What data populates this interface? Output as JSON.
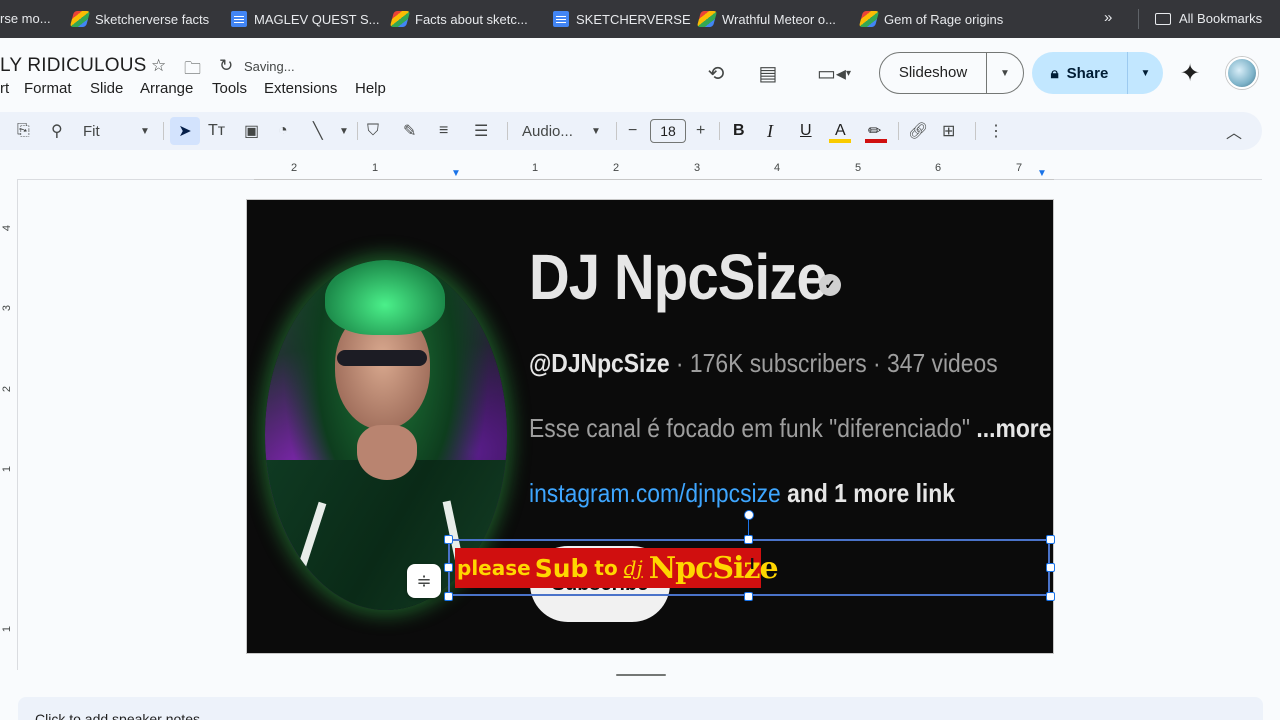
{
  "bookmarks": {
    "items": [
      {
        "label": "rse mo...",
        "icon": "none"
      },
      {
        "label": "Sketcherverse facts",
        "icon": "stripe"
      },
      {
        "label": "MAGLEV QUEST S...",
        "icon": "doc"
      },
      {
        "label": "Facts about sketc...",
        "icon": "stripe"
      },
      {
        "label": "SKETCHERVERSE",
        "icon": "doc"
      },
      {
        "label": "Wrathful Meteor o...",
        "icon": "stripe"
      },
      {
        "label": "Gem of Rage origins",
        "icon": "stripe"
      }
    ],
    "more": "»",
    "all_bookmarks": "All Bookmarks"
  },
  "doc": {
    "title": "LY RIDICULOUS",
    "status": "Saving..."
  },
  "menu": [
    "rt",
    "Format",
    "Slide",
    "Arrange",
    "Tools",
    "Extensions",
    "Help"
  ],
  "header": {
    "slideshow_label": "Slideshow",
    "share_label": "Share"
  },
  "toolbar": {
    "zoom": "Fit",
    "font": "Audio...",
    "font_size": "18",
    "bold": "B",
    "italic": "I",
    "underline": "U",
    "text_color": "A",
    "text_color_bar": "#f9cb00",
    "highlight_bar": "#d00f0f"
  },
  "ruler": {
    "numbers": [
      "2",
      "1",
      "1",
      "2",
      "3",
      "4",
      "5",
      "6",
      "7"
    ],
    "vnumbers": [
      "4",
      "3",
      "2",
      "1",
      "1"
    ]
  },
  "slide": {
    "channel_name": "DJ NpcSize",
    "handle": "@DJNpcSize",
    "stats": " · 176K subscribers · 347 videos",
    "description": "Esse canal é focado em funk \"diferenciado\" ",
    "more": "...more",
    "link": "instagram.com/djnpcsize",
    "link_rest": " and 1 more link",
    "subscribe": "Subscribe",
    "overlay": {
      "part1": "please",
      "part2": "Sub",
      "part3": "to",
      "part4": "dj",
      "part5": "NpcSize"
    }
  },
  "notes": {
    "placeholder": "Click to add speaker notes"
  }
}
